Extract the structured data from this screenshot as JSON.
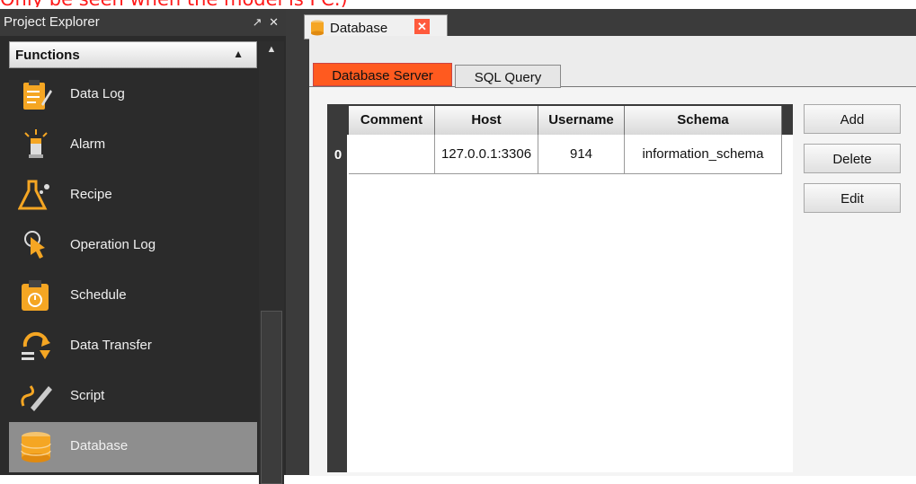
{
  "caption": "Only be seen when the model is PC.)",
  "explorer": {
    "title": "Project Explorer",
    "window_controls": "↗ ✕",
    "section_header": "Functions",
    "items": [
      {
        "label": "Data Log",
        "icon": "data-log-icon"
      },
      {
        "label": "Alarm",
        "icon": "alarm-icon"
      },
      {
        "label": "Recipe",
        "icon": "recipe-icon"
      },
      {
        "label": "Operation Log",
        "icon": "operation-log-icon"
      },
      {
        "label": "Schedule",
        "icon": "schedule-icon"
      },
      {
        "label": "Data Transfer",
        "icon": "data-transfer-icon"
      },
      {
        "label": "Script",
        "icon": "script-icon"
      },
      {
        "label": "Database",
        "icon": "database-icon",
        "selected": true
      }
    ]
  },
  "document_tab": {
    "label": "Database",
    "close_glyph": "✕"
  },
  "subtabs": [
    "Database Server",
    "SQL Query"
  ],
  "table": {
    "columns": [
      "Comment",
      "Host",
      "Username",
      "Schema"
    ],
    "rows": [
      {
        "index": "0",
        "comment": "",
        "host": "127.0.0.1:3306",
        "username": "914",
        "schema": "information_schema"
      }
    ]
  },
  "buttons": {
    "add": "Add",
    "delete": "Delete",
    "edit": "Edit"
  },
  "colors": {
    "accent": "#ff5a1f",
    "selected_item": "#8e8e8e",
    "panel_dark": "#2b2b2b"
  }
}
